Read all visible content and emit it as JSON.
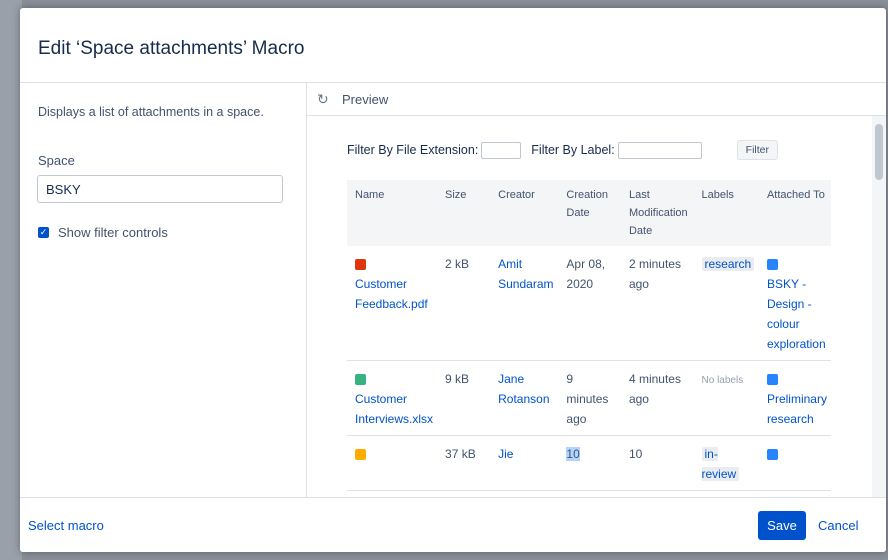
{
  "dialog": {
    "title": "Edit ‘Space attachments’ Macro"
  },
  "left_pane": {
    "description": "Displays a list of attachments in a space.",
    "space_label": "Space",
    "space_value": "BSKY",
    "show_filter_label": "Show filter controls",
    "show_filter_checked": true
  },
  "preview": {
    "label": "Preview",
    "icon": "refresh-icon",
    "filter": {
      "extension_label": "Filter By File Extension:",
      "label_label": "Filter By Label:",
      "button": "Filter"
    },
    "table": {
      "headers": [
        "Name",
        "Size",
        "Creator",
        "Creation Date",
        "Last Modification Date",
        "Labels",
        "Attached To"
      ],
      "rows": [
        {
          "icon": "pdf-file-icon",
          "icon_color": "#de350b",
          "name": "Customer Feedback.pdf",
          "size": "2 kB",
          "creator": "Amit Sundaram",
          "created": "Apr 08, 2020",
          "modified": "2 minutes ago",
          "label": "research",
          "attached_to": "BSKY - Design - colour exploration"
        },
        {
          "icon": "spreadsheet-file-icon",
          "icon_color": "#36b37e",
          "name": "Customer Interviews.xlsx",
          "size": "9 kB",
          "creator": "Jane Rotanson",
          "created": "9 minutes ago",
          "modified": "4 minutes ago",
          "no_labels": "No labels",
          "attached_to": "Preliminary research"
        },
        {
          "icon": "image-file-icon",
          "icon_color": "#ffab00",
          "size": "37 kB",
          "creator": "Jie",
          "created": "10",
          "modified": "10",
          "label": "in-review"
        }
      ]
    }
  },
  "footer": {
    "select_macro": "Select macro",
    "save": "Save",
    "cancel": "Cancel"
  },
  "colors": {
    "accent": "#0052cc",
    "page_icon": "#2684ff"
  }
}
